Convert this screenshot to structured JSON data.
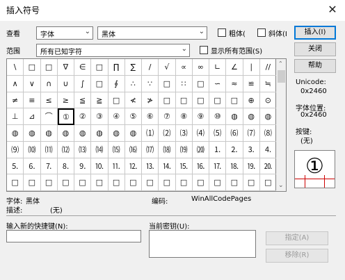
{
  "window": {
    "title": "插入符号",
    "close_glyph": "✕"
  },
  "view": {
    "label": "查看",
    "combo1": "字体",
    "combo2": "黑体"
  },
  "checks": {
    "bold": "粗体(",
    "italic": "斜体(I"
  },
  "range": {
    "label": "范围",
    "value": "所有已知字符"
  },
  "show_all": "显示所有范围(S)",
  "buttons": {
    "insert": "插入(I)",
    "close": "关闭",
    "help": "帮助",
    "assign": "指定(A)",
    "remove": "移除(R)"
  },
  "grid": {
    "rows": [
      [
        "\\",
        "□",
        "□",
        "∇",
        "∈",
        "□",
        "∏",
        "∑",
        "/",
        "√",
        "∝",
        "∞",
        "∟",
        "∠",
        "∣",
        "//"
      ],
      [
        "∧",
        "∨",
        "∩",
        "∪",
        "∫",
        "□",
        "∮",
        "∴",
        "∵",
        "□",
        "∷",
        "□",
        "∽",
        "≈",
        "≌",
        "≒"
      ],
      [
        "≠",
        "≡",
        "≤",
        "≥",
        "≦",
        "≧",
        "□",
        "≮",
        "≯",
        "□",
        "□",
        "□",
        "□",
        "□",
        "⊕",
        "⊙"
      ],
      [
        "⊥",
        "⊿",
        "⌒",
        "①",
        "②",
        "③",
        "④",
        "⑤",
        "⑥",
        "⑦",
        "⑧",
        "⑨",
        "⑩",
        "◍",
        "◍",
        "◍"
      ],
      [
        "◍",
        "◍",
        "◍",
        "◍",
        "◍",
        "◍",
        "◍",
        "◍",
        "⑴",
        "⑵",
        "⑶",
        "⑷",
        "⑸",
        "⑹",
        "⑺",
        "⑻"
      ],
      [
        "⑼",
        "⑽",
        "⑾",
        "⑿",
        "⒀",
        "⒁",
        "⒂",
        "⒃",
        "⒄",
        "⒅",
        "⒆",
        "⒇",
        "⒈",
        "⒉",
        "⒊",
        "⒋"
      ],
      [
        "⒌",
        "⒍",
        "⒎",
        "⒏",
        "⒐",
        "⒑",
        "⒒",
        "⒓",
        "⒔",
        "⒕",
        "⒖",
        "⒗",
        "⒘",
        "⒙",
        "⒚",
        "⒛"
      ],
      [
        "□",
        "□",
        "□",
        "□",
        "□",
        "□",
        "□",
        "□",
        "□",
        "□",
        "□",
        "□",
        "□",
        "□",
        "□",
        "□"
      ]
    ],
    "selected": {
      "row": 3,
      "col": 3
    }
  },
  "info": {
    "unicode_label": "Unicode:",
    "unicode_value": "0x2460",
    "font_pos_label": "字体位置:",
    "font_pos_value": "0x2460",
    "key_label": "按键:",
    "key_value": "(无)",
    "preview_char": "①"
  },
  "status": {
    "font_label": "字体:",
    "font_value": "黑体",
    "desc_label": "描述:",
    "desc_value": "(无)",
    "encoding_label": "编码:",
    "encoding_value": "WinAllCodePages"
  },
  "shortcut": {
    "label": "输入新的快捷键(N):",
    "current_label": "当前密钥(U):"
  }
}
